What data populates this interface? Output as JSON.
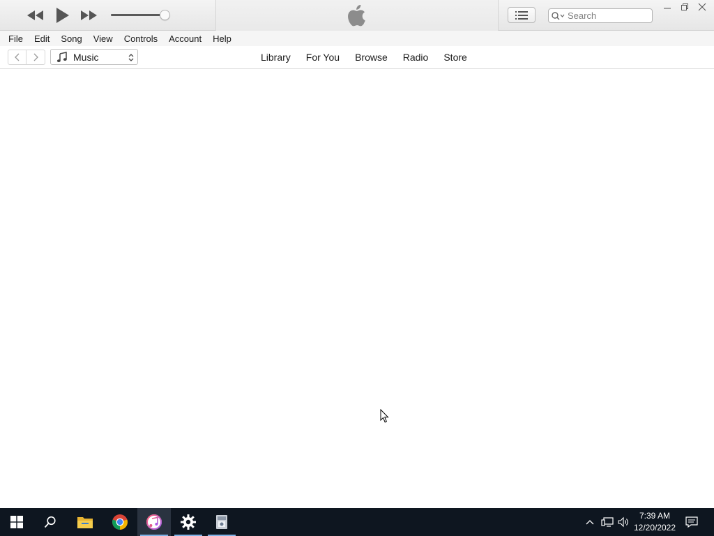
{
  "player": {
    "volume_level": 1.0
  },
  "search": {
    "placeholder": "Search"
  },
  "menu": [
    "File",
    "Edit",
    "Song",
    "View",
    "Controls",
    "Account",
    "Help"
  ],
  "source": {
    "label": "Music"
  },
  "tabs": [
    "Library",
    "For You",
    "Browse",
    "Radio",
    "Store"
  ],
  "taskbar": {
    "apps": [
      "start-icon",
      "search-icon",
      "file-explorer-icon",
      "chrome-icon",
      "itunes-icon",
      "settings-icon",
      "installer-icon"
    ],
    "time": "7:39 AM",
    "date": "12/20/2022"
  },
  "colors": {
    "taskbar": "#0e1620",
    "accent": "#7fb2e6"
  }
}
